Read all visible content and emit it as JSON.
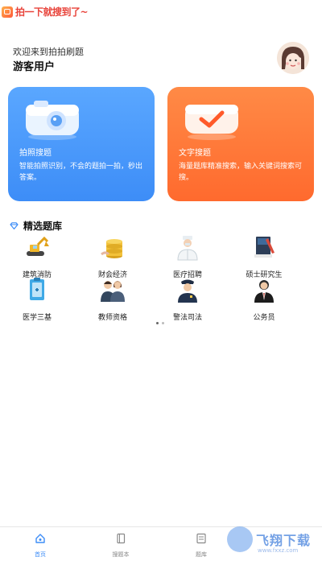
{
  "app": {
    "logo_text": "拍一下就搜到了~"
  },
  "header": {
    "welcome": "欢迎来到拍拍刷题",
    "username": "游客用户"
  },
  "cards": [
    {
      "title": "拍照搜题",
      "desc": "智能拍照识别，不会的题拍一拍，秒出答案。",
      "color": "#4a97fb"
    },
    {
      "title": "文字搜题",
      "desc": "海量题库精准搜索，输入关键词搜索可搜。",
      "color": "#ff7a3a"
    }
  ],
  "section": {
    "title": "精选题库"
  },
  "categories": [
    {
      "label": "建筑消防",
      "icon": "excavator-icon"
    },
    {
      "label": "财会经济",
      "icon": "coins-icon"
    },
    {
      "label": "医疗招聘",
      "icon": "doctor-icon"
    },
    {
      "label": "硕士研究生",
      "icon": "books-icon"
    },
    {
      "label": "医学三基",
      "icon": "medical-board-icon"
    },
    {
      "label": "教师资格",
      "icon": "teachers-icon"
    },
    {
      "label": "警法司法",
      "icon": "police-icon"
    },
    {
      "label": "公务员",
      "icon": "civil-servant-icon"
    }
  ],
  "tabs": [
    {
      "label": "首页",
      "icon": "home-icon",
      "active": true
    },
    {
      "label": "搜题本",
      "icon": "notebook-icon",
      "active": false
    },
    {
      "label": "题库",
      "icon": "question-bank-icon",
      "active": false
    }
  ],
  "watermark": {
    "text": "飞翔下载",
    "url": "www.fxxz.com"
  },
  "colors": {
    "accent": "#3d8df7",
    "brand_red": "#e8433a"
  }
}
